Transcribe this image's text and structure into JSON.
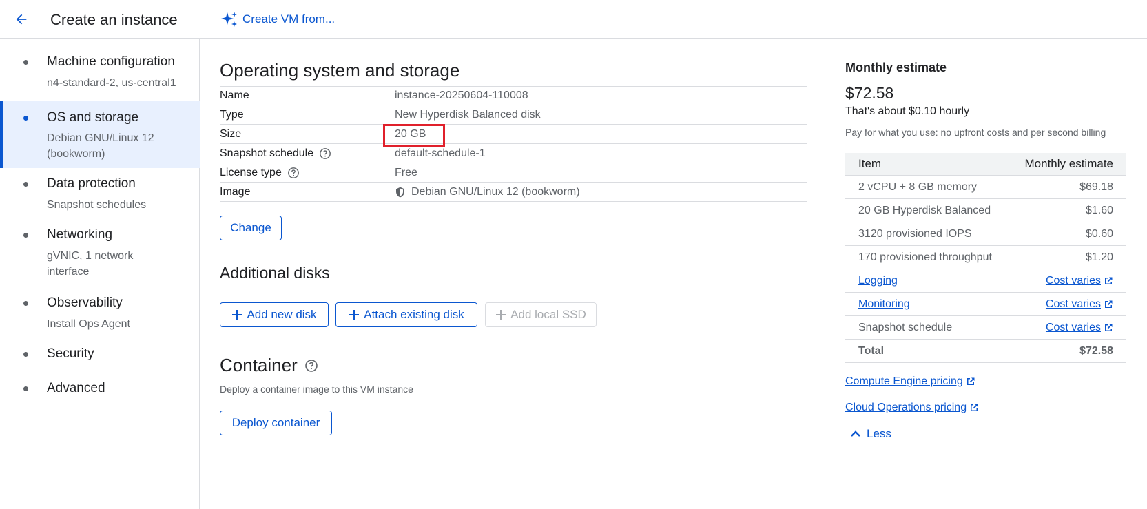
{
  "header": {
    "title": "Create an instance",
    "create_from_label": "Create VM from..."
  },
  "sidebar": {
    "items": [
      {
        "label": "Machine configuration",
        "sub": "n4-standard-2, us-central1"
      },
      {
        "label": "OS and storage",
        "sub": "Debian GNU/Linux 12 (bookworm)",
        "active": true
      },
      {
        "label": "Data protection",
        "sub": "Snapshot schedules"
      },
      {
        "label": "Networking",
        "sub": "gVNIC, 1 network interface"
      },
      {
        "label": "Observability",
        "sub": "Install Ops Agent"
      },
      {
        "label": "Security",
        "sub": ""
      },
      {
        "label": "Advanced",
        "sub": ""
      }
    ]
  },
  "os_storage": {
    "title": "Operating system and storage",
    "rows": [
      {
        "key": "Name",
        "value": "instance-20250604-110008"
      },
      {
        "key": "Type",
        "value": "New Hyperdisk Balanced disk"
      },
      {
        "key": "Size",
        "value": "20 GB"
      },
      {
        "key": "Snapshot schedule",
        "value": "default-schedule-1"
      },
      {
        "key": "License type",
        "value": "Free"
      },
      {
        "key": "Image",
        "value": "Debian GNU/Linux 12 (bookworm)"
      }
    ],
    "change_label": "Change"
  },
  "additional_disks": {
    "title": "Additional disks",
    "add_new_label": "Add new disk",
    "attach_existing_label": "Attach existing disk",
    "add_local_ssd_label": "Add local SSD"
  },
  "container": {
    "title": "Container",
    "description": "Deploy a container image to this VM instance",
    "deploy_label": "Deploy container"
  },
  "estimate": {
    "title": "Monthly estimate",
    "price": "$72.58",
    "hourly": "That's about $0.10 hourly",
    "note": "Pay for what you use: no upfront costs and per second billing",
    "header": {
      "item": "Item",
      "cost": "Monthly estimate"
    },
    "rows": [
      {
        "item": "2 vCPU + 8 GB memory",
        "cost": "$69.18"
      },
      {
        "item": "20 GB Hyperdisk Balanced",
        "cost": "$1.60"
      },
      {
        "item": "3120 provisioned IOPS",
        "cost": "$0.60"
      },
      {
        "item": "170 provisioned throughput",
        "cost": "$1.20"
      },
      {
        "item": "Logging",
        "cost": "Cost varies"
      },
      {
        "item": "Monitoring",
        "cost": "Cost varies"
      },
      {
        "item": "Snapshot schedule",
        "cost": "Cost varies"
      }
    ],
    "total": {
      "item": "Total",
      "cost": "$72.58"
    },
    "compute_pricing_link": "Compute Engine pricing",
    "cloud_ops_pricing_link": "Cloud Operations pricing",
    "less_label": "Less"
  },
  "colors": {
    "accent": "#0b57d0",
    "highlight": "#e0202b",
    "active_bg": "#e8f0fe"
  }
}
